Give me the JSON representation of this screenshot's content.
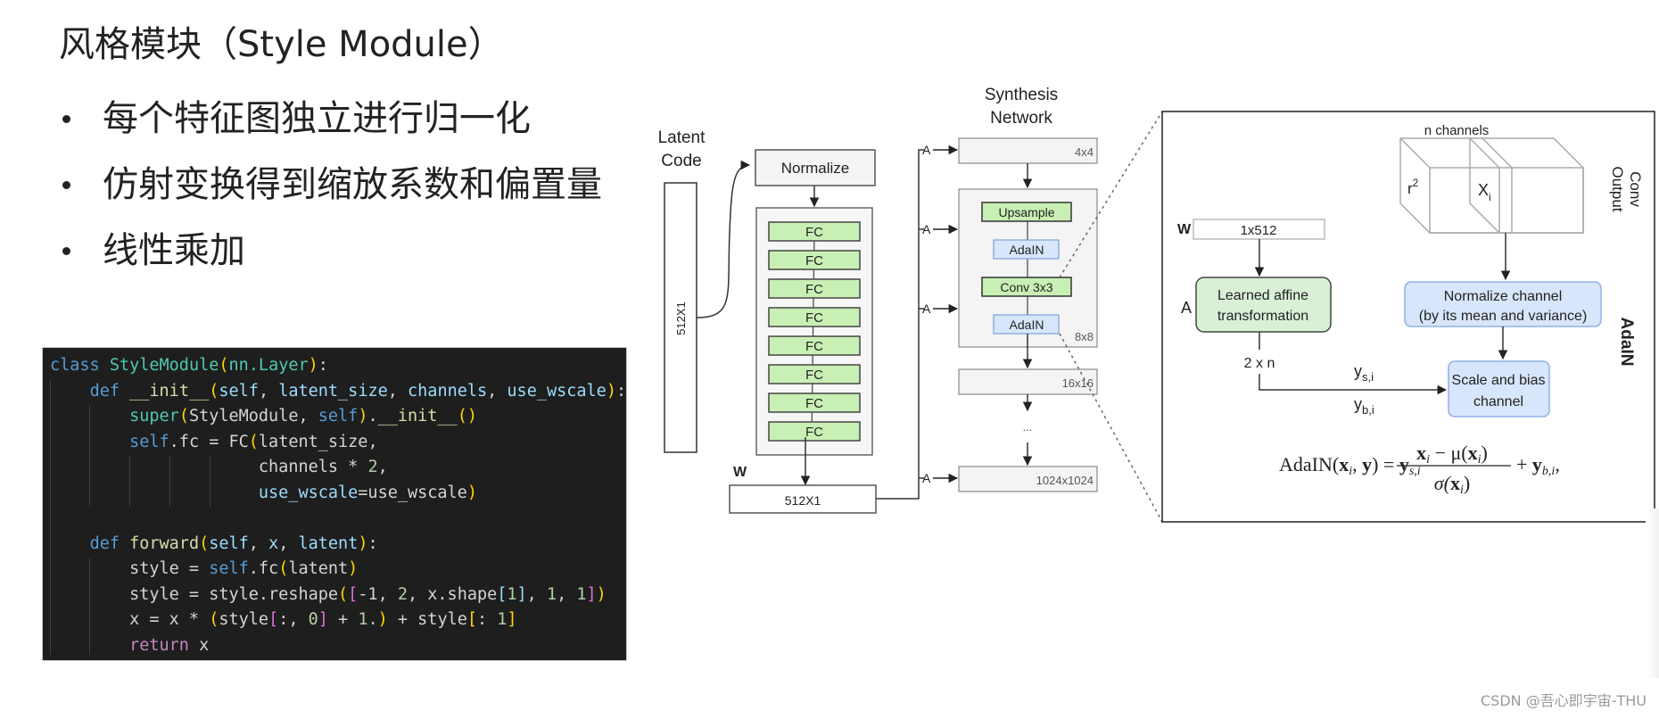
{
  "slide": {
    "title": "风格模块（Style Module）",
    "bullets": [
      "每个特征图独立进行归一化",
      "仿射变换得到缩放系数和偏置量",
      "线性乘加"
    ]
  },
  "code": {
    "language": "python",
    "lines": [
      "class StyleModule(nn.Layer):",
      "    def __init__(self, latent_size, channels, use_wscale):",
      "        super(StyleModule, self).__init__()",
      "        self.fc = FC(latent_size,",
      "                     channels * 2,",
      "                     use_wscale=use_wscale)",
      "",
      "    def forward(self, x, latent):",
      "        style = self.fc(latent)",
      "        style = style.reshape([-1, 2, x.shape[1], 1, 1])",
      "        x = x * (style[:, 0] + 1.) + style[: 1]",
      "        return x"
    ],
    "tokens": {
      "l0": [
        "class",
        "StyleModule",
        "(",
        "nn.Layer",
        ")",
        ":"
      ],
      "l1_def": "def",
      "l1_fn": "__init__",
      "l1_params": [
        "self",
        "latent_size",
        "channels",
        "use_wscale"
      ],
      "l2_super": "super",
      "l2_cls": "StyleModule",
      "l2_self": "self",
      "l2_init": "__init__",
      "l3_self": "self",
      "l3_rest": ".fc = FC",
      "l3_arg": "latent_size,",
      "l4_a": "channels * ",
      "l4_num": "2",
      "l5_param": "use_wscale",
      "l5_val": "=use_wscale",
      "l7_def": "def",
      "l7_fn": "forward",
      "l7_params": [
        "self",
        "x",
        "latent"
      ],
      "l8_a": "style = ",
      "l8_self": "self",
      "l8_b": ".fc",
      "l8_c": "latent",
      "l9_a": "style = style.reshape",
      "l9_n1": "-1",
      "l9_n2": "2",
      "l9_b": "x.shape",
      "l9_n3": "1",
      "l9_n4": "1",
      "l9_n5": "1",
      "l10_a": "x = x * ",
      "l10_b": "style",
      "l10_c": ":, ",
      "l10_n0": "0",
      "l10_d": " + ",
      "l10_n1": "1.",
      "l10_e": " + style",
      "l10_f": ": ",
      "l10_n2": "1",
      "l11_ret": "return",
      "l11_x": " x"
    }
  },
  "mapping_network": {
    "latent_label_1": "Latent",
    "latent_label_2": "Code",
    "latent_dim": "512X1",
    "normalize": "Normalize",
    "fc_layers": [
      "FC",
      "FC",
      "FC",
      "FC",
      "FC",
      "FC",
      "FC",
      "FC"
    ],
    "w_label": "W",
    "w_dim": "512X1"
  },
  "synthesis_network": {
    "title_1": "Synthesis",
    "title_2": "Network",
    "a_label": "A",
    "blocks": {
      "res_4": "4x4",
      "upsample": "Upsample",
      "adain": "AdaIN",
      "conv": "Conv 3x3",
      "res_8": "8x8",
      "res_16": "16x16",
      "ellipsis": "...",
      "res_1024": "1024x1024"
    }
  },
  "adain_detail": {
    "n_channels": "n channels",
    "r2": "r",
    "r2_sup": "2",
    "xi": "X",
    "xi_sub": "i",
    "conv_output_1": "Conv",
    "conv_output_2": "Output",
    "w_label": "W",
    "w_dim": "1x512",
    "a_label": "A",
    "affine_1": "Learned affine",
    "affine_2": "transformation",
    "two_n": "2 x n",
    "ys": "y",
    "ys_sub": "s,i",
    "yb": "y",
    "yb_sub": "b,i",
    "normalize_1": "Normalize channel",
    "normalize_2": "(by its mean and variance)",
    "scale_1": "Scale and bias",
    "scale_2": "channel",
    "side_label": "AdaIN",
    "formula": {
      "lhs": "AdaIN(",
      "lhs_x": "x",
      "lhs_i": "i",
      "lhs_mid": ", ",
      "lhs_y": "y",
      "lhs_end": ") = ",
      "ys": "y",
      "ys_sub": "s,i",
      "num_x": "x",
      "num_i": "i",
      "num_mid": " − μ(",
      "num_x2": "x",
      "num_i2": "i",
      "num_end": ")",
      "den_a": "σ(",
      "den_x": "x",
      "den_i": "i",
      "den_end": ")",
      "plus": "+ ",
      "yb": "y",
      "yb_sub": "b,i",
      "comma": ","
    }
  },
  "watermark": "CSDN @吾心即宇宙-THU"
}
